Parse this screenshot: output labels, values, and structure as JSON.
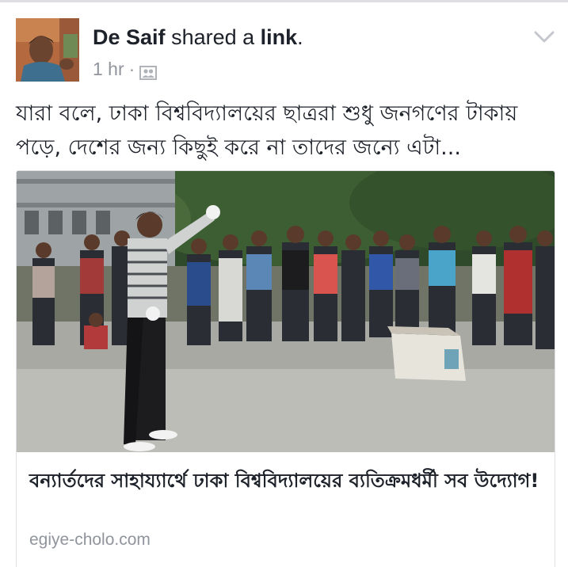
{
  "post": {
    "author": "De Saif",
    "action": "shared a",
    "object": "link",
    "period": ".",
    "time": "1 hr",
    "separator": "·",
    "privacy_icon": "friends-icon",
    "menu_icon": "chevron-down-icon",
    "text": "যারা বলে, ঢাকা বিশ্ববিদ্যালয়ের ছাত্ররা শুধু জনগণের টাকায় পড়ে, দেশের জন্য কিছুই করে না তাদের জন্যে এটা..."
  },
  "link": {
    "title": "বন্যার্তদের সাহায্যার্থে ঢাকা বিশ্ববিদ্যালয়ের ব্যতিক্রমধর্মী সব উদ্যোগ!",
    "domain": "egiye-cholo.com"
  },
  "colors": {
    "text_primary": "#1d2129",
    "text_secondary": "#90949c",
    "border": "#dddfe2"
  }
}
